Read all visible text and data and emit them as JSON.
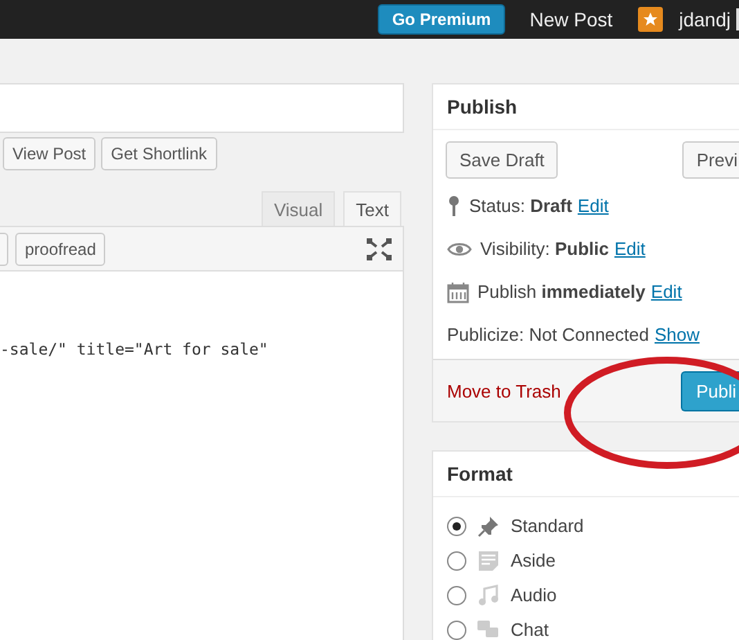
{
  "top_bar": {
    "premium_button": "Go Premium",
    "new_post": "New Post",
    "user": "jdandj"
  },
  "editor": {
    "buttons": [
      "View Post",
      "Get Shortlink"
    ],
    "tabs": [
      {
        "label": "Visual",
        "selected": false
      },
      {
        "label": "Text",
        "selected": true
      }
    ],
    "toolbar_buttons": [
      "proofread"
    ],
    "code_line": "-sale/\" title=\"Art for sale\""
  },
  "publish": {
    "title": "Publish",
    "save_draft": "Save Draft",
    "preview": "Previ",
    "meta": [
      {
        "kind": "pin",
        "text": "Status: **Draft**",
        "link": "Edit"
      },
      {
        "kind": "eye",
        "text": "Visibility: **Public**",
        "link": "Edit"
      },
      {
        "kind": "calendar",
        "text": "Publish **immediately**",
        "link": "Edit"
      },
      {
        "kind": "plain",
        "text": "Publicize: Not Connected",
        "link": "Show"
      }
    ],
    "trash": "Move to Trash",
    "publish_button": "Publi"
  },
  "format": {
    "title": "Format",
    "options": [
      {
        "kind": "standard",
        "label": "Standard",
        "selected": true
      },
      {
        "kind": "aside",
        "label": "Aside",
        "selected": false
      },
      {
        "kind": "audio",
        "label": "Audio",
        "selected": false
      },
      {
        "kind": "chat",
        "label": "Chat",
        "selected": false
      }
    ]
  }
}
